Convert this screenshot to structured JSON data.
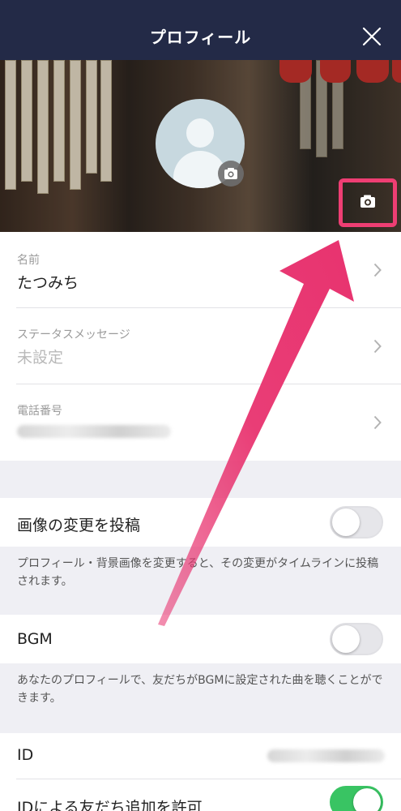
{
  "header": {
    "title": "プロフィール",
    "close_icon": "close-icon"
  },
  "cover": {
    "camera_icon": "camera-icon",
    "highlight_color": "#ee3e73"
  },
  "avatar": {
    "camera_icon": "camera-icon"
  },
  "profile": {
    "name": {
      "label": "名前",
      "value": "たつみち"
    },
    "status": {
      "label": "ステータスメッセージ",
      "value": "未設定"
    },
    "phone": {
      "label": "電話番号",
      "value_masked": true
    }
  },
  "settings": {
    "post_image_change": {
      "label": "画像の変更を投稿",
      "enabled": false,
      "note": "プロフィール・背景画像を変更すると、その変更がタイムラインに投稿されます。"
    },
    "bgm": {
      "label": "BGM",
      "enabled": false,
      "note": "あなたのプロフィールで、友だちがBGMに設定された曲を聴くことができます。"
    },
    "id": {
      "label": "ID",
      "value_masked": true
    },
    "allow_add_by_id": {
      "label": "IDによる友だち追加を許可",
      "enabled": true
    }
  },
  "colors": {
    "navbar": "#232a47",
    "toggle_on": "#39c463",
    "arrow": "#e8336f"
  }
}
